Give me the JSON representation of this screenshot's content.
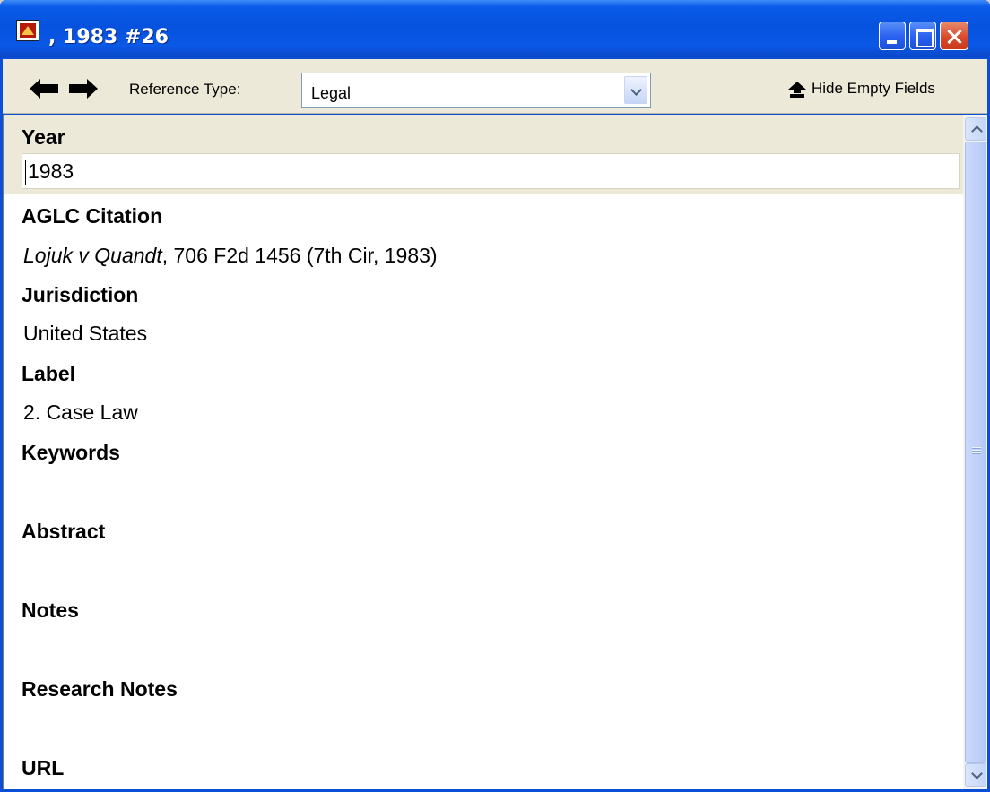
{
  "window": {
    "title": ", 1983 #26",
    "app_icon": "endnote-app-icon",
    "controls": [
      "minimize-icon",
      "maximize-icon",
      "close-icon"
    ]
  },
  "toolbar": {
    "back_icon": "arrow-left-icon",
    "forward_icon": "arrow-right-icon",
    "reference_type_label": "Reference Type:",
    "reference_type_value": "Legal",
    "hide_empty_icon": "hide-fields-up-arrow-icon",
    "hide_empty_label": "Hide Empty Fields"
  },
  "fields": {
    "year": {
      "label": "Year",
      "value": "1983"
    },
    "aglc_citation": {
      "label": "AGLC Citation",
      "case_name": "Lojuk v Quandt",
      "citation_rest": ", 706 F2d 1456 (7th Cir, 1983)"
    },
    "jurisdiction": {
      "label": "Jurisdiction",
      "value": "United States"
    },
    "label": {
      "label": "Label",
      "value": "2. Case Law"
    },
    "keywords": {
      "label": "Keywords",
      "value": ""
    },
    "abstract": {
      "label": "Abstract",
      "value": ""
    },
    "notes": {
      "label": "Notes",
      "value": ""
    },
    "research_notes": {
      "label": "Research Notes",
      "value": ""
    },
    "url": {
      "label": "URL",
      "value": ""
    }
  },
  "colors": {
    "titlebar": "#0652df",
    "toolbar_bg": "#ece9d8",
    "close_button": "#d94a2a",
    "content_bg": "#ffffff"
  }
}
